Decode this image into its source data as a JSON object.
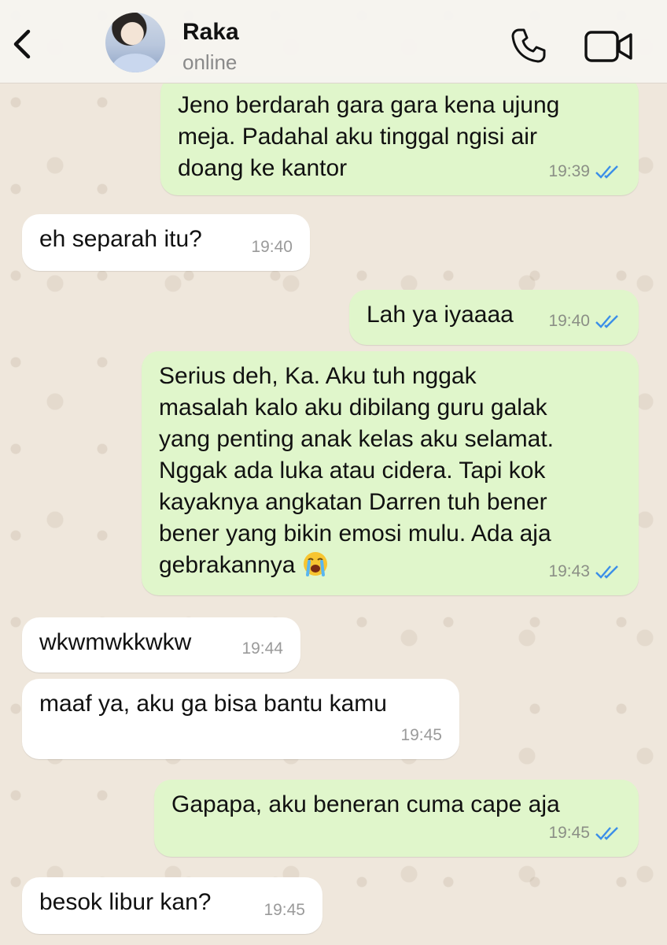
{
  "contact": {
    "name": "Raka",
    "status": "online"
  },
  "colors": {
    "outgoing_bubble": "#e0f6cb",
    "incoming_bubble": "#ffffff",
    "read_ticks": "#3b8ee8",
    "wallpaper": "#efe7dc"
  },
  "icons": {
    "back": "chevron-left-icon",
    "call": "phone-icon",
    "video": "video-camera-icon",
    "read_receipt": "double-check-icon",
    "emoji": "loudly-crying-face-icon"
  },
  "messages": [
    {
      "direction": "out",
      "text": "Jeno berdarah gara gara kena ujung\nmeja. Padahal aku tinggal ngisi air\ndoang ke kantor",
      "time": "19:39",
      "read": true
    },
    {
      "direction": "in",
      "text": "eh separah itu?",
      "time": "19:40"
    },
    {
      "direction": "out",
      "text": "Lah ya iyaaaa",
      "time": "19:40",
      "read": true
    },
    {
      "direction": "out",
      "text": "Serius deh, Ka. Aku tuh nggak\nmasalah kalo aku dibilang guru galak\nyang penting anak kelas aku selamat.\nNggak ada luka atau cidera. Tapi kok\nkayaknya angkatan Darren tuh bener\nbener yang bikin emosi mulu. Ada aja\ngebrakannya",
      "time": "19:43",
      "read": true,
      "emoji": "😭"
    },
    {
      "direction": "in",
      "text": "wkwmwkkwkw",
      "time": "19:44"
    },
    {
      "direction": "in",
      "text": "maaf ya, aku ga bisa bantu kamu",
      "time": "19:45"
    },
    {
      "direction": "out",
      "text": "Gapapa, aku beneran cuma cape aja",
      "time": "19:45",
      "read": true
    },
    {
      "direction": "in",
      "text": "besok libur kan?",
      "time": "19:45"
    }
  ]
}
